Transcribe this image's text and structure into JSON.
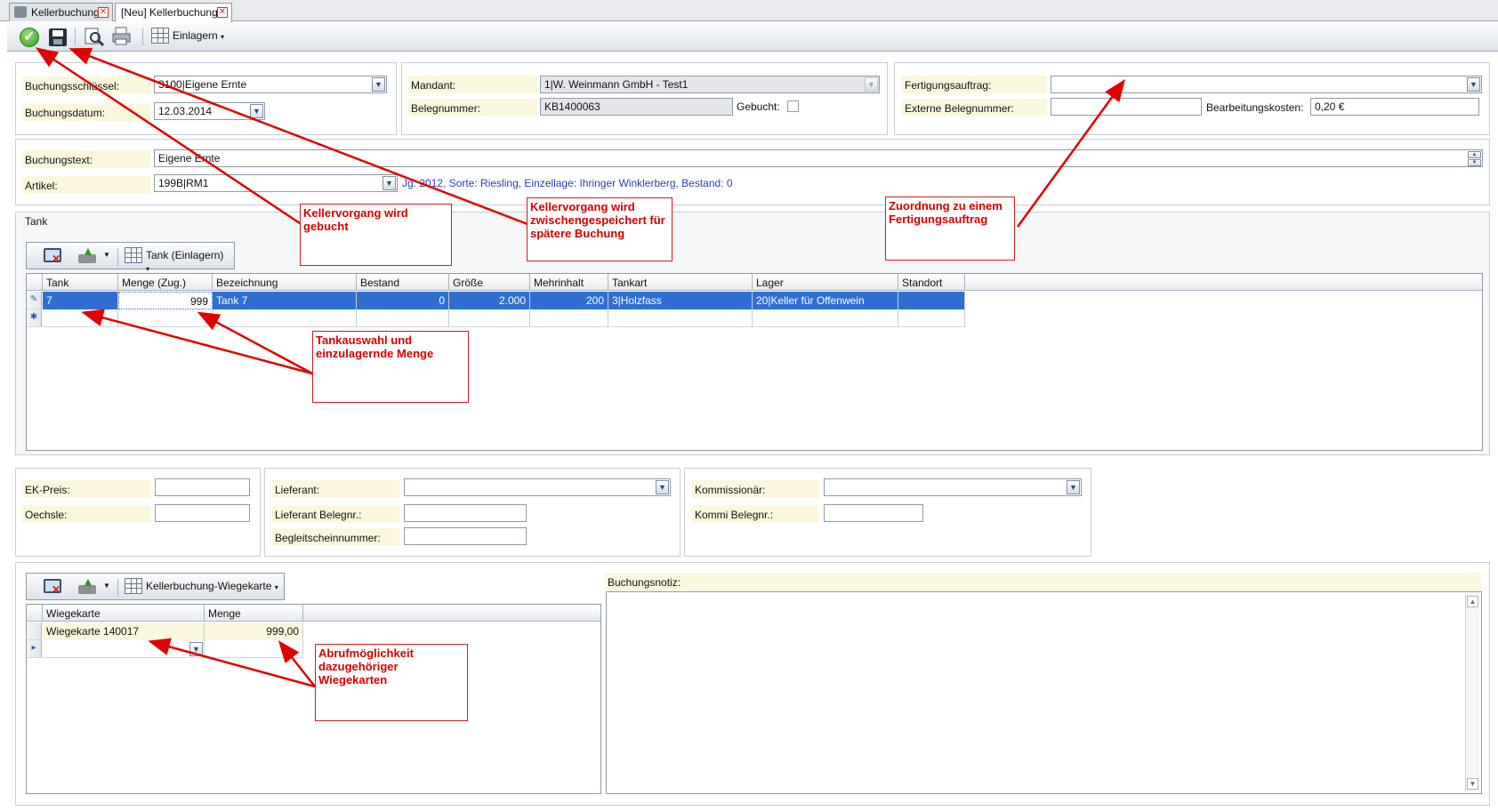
{
  "tabs": [
    {
      "label": "Kellerbuchung",
      "close": "✕"
    },
    {
      "label": "[Neu] Kellerbuchung",
      "close": "✕"
    }
  ],
  "toolbar": {
    "einlagern_label": "Einlagern",
    "caret": "▾"
  },
  "header_left": {
    "buchungsschluessel_label": "Buchungsschlüssel:",
    "buchungsschluessel_value": "3100|Eigene Ernte",
    "buchungsdatum_label": "Buchungsdatum:",
    "buchungsdatum_value": "12.03.2014"
  },
  "header_mid": {
    "mandant_label": "Mandant:",
    "mandant_value": "1|W. Weinmann GmbH - Test1",
    "belegnummer_label": "Belegnummer:",
    "belegnummer_value": "KB1400063",
    "gebucht_label": "Gebucht:"
  },
  "header_right": {
    "fertigungsauftrag_label": "Fertigungsauftrag:",
    "fertigungsauftrag_value": "",
    "externe_label": "Externe Belegnummer:",
    "externe_value": "",
    "bearbeitungskosten_label": "Bearbeitungskosten:",
    "bearbeitungskosten_value": "0,20 €"
  },
  "text_section": {
    "buchungstext_label": "Buchungstext:",
    "buchungstext_value": "Eigene Ernte",
    "artikel_label": "Artikel:",
    "artikel_value": "199B|RM1",
    "artikel_info": "Jg: 2012, Sorte: Riesling, Einzellage: Ihringer Winklerberg, Bestand: 0"
  },
  "tank_section": {
    "title": "Tank",
    "dropdown_label": "Tank (Einlagern)",
    "columns": [
      "Tank",
      "Menge (Zug.)",
      "Bezeichnung",
      "Bestand",
      "Größe",
      "Mehrinhalt",
      "Tankart",
      "Lager",
      "Standort"
    ],
    "rows": [
      {
        "tank": "7",
        "menge": "999",
        "bezeichnung": "Tank 7",
        "bestand": "0",
        "groesse": "2.000",
        "mehrinhalt": "200",
        "tankart": "3|Holzfass",
        "lager": "20|Keller für Offenwein",
        "standort": ""
      }
    ]
  },
  "purchase_section": {
    "ek_preis_label": "EK-Preis:",
    "ek_preis_value": "",
    "oechsle_label": "Oechsle:",
    "oechsle_value": "",
    "lieferant_label": "Lieferant:",
    "lieferant_value": "",
    "lieferant_belegnr_label": "Lieferant Belegnr.:",
    "lieferant_belegnr_value": "",
    "begleitschein_label": "Begleitscheinnummer:",
    "begleitschein_value": "",
    "kommissionaer_label": "Kommissionär:",
    "kommissionaer_value": "",
    "kommi_belegnr_label": "Kommi Belegnr.:",
    "kommi_belegnr_value": ""
  },
  "wiege_section": {
    "dropdown_label": "Kellerbuchung-Wiegekarte",
    "columns": [
      "Wiegekarte",
      "Menge"
    ],
    "rows": [
      {
        "wiegekarte": "Wiegekarte 140017",
        "menge": "999,00"
      }
    ]
  },
  "notiz": {
    "label": "Buchungsnotiz:",
    "value": ""
  },
  "annotations": [
    {
      "text": "Kellervorgang wird gebucht"
    },
    {
      "text": "Kellervorgang wird zwischengespeichert für spätere Buchung"
    },
    {
      "text": "Zuordnung zu einem Fertigungsauftrag"
    },
    {
      "text": "Tankauswahl und einzulagernde Menge"
    },
    {
      "text": "Abrufmöglichkeit dazugehöriger Wiegekarten"
    }
  ],
  "colors": {
    "selection": "#2f6fd0",
    "label_bg": "#fbf7dc",
    "annotation": "#d40000",
    "info_text": "#2a3fae"
  },
  "icons": [
    "check-icon",
    "save-icon",
    "preview-icon",
    "print-icon",
    "grid-icon",
    "delete-row-icon",
    "export-icon",
    "edit-row-icon",
    "new-row-icon",
    "close-icon"
  ]
}
